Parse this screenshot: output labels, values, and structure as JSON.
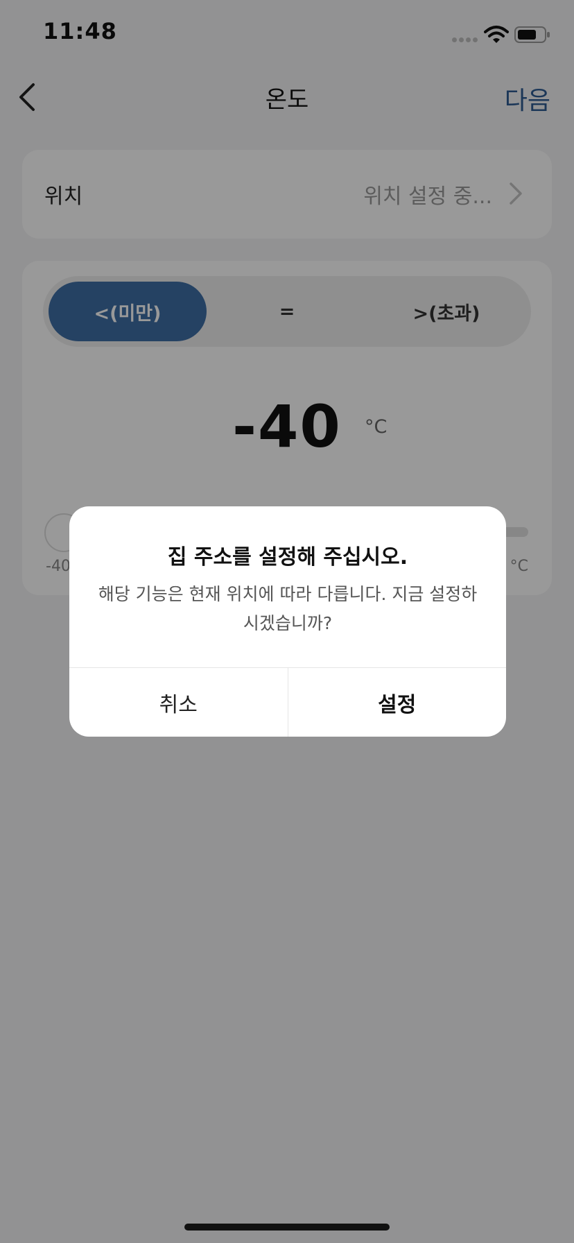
{
  "status_bar": {
    "time": "11:48",
    "signal_icon": "signal-dots-icon",
    "wifi_icon": "wifi-icon",
    "battery_icon": "battery-icon"
  },
  "nav": {
    "back_icon": "chevron-left-icon",
    "title": "온도",
    "next_label": "다음"
  },
  "location": {
    "label": "위치",
    "value": "위치 설정 중...",
    "chevron_icon": "chevron-right-icon"
  },
  "condition": {
    "options": [
      {
        "label": "<(미만)",
        "selected": true
      },
      {
        "label": "=",
        "selected": false
      },
      {
        "label": ">(초과)",
        "selected": false
      }
    ],
    "value": "-40",
    "unit": "°C",
    "slider": {
      "min_label": "-40",
      "max_label": "°C",
      "position_fraction": 0
    }
  },
  "dialog": {
    "title": "집 주소를 설정해 주십시오.",
    "message": "해당 기능은 현재 위치에 따라 다릅니다. 지금 설정하시겠습니까?",
    "cancel_label": "취소",
    "confirm_label": "설정"
  },
  "colors": {
    "accent": "#3f6fa6",
    "nav_next": "#2f5d93",
    "overlay": "rgba(0,0,0,0.40)"
  }
}
